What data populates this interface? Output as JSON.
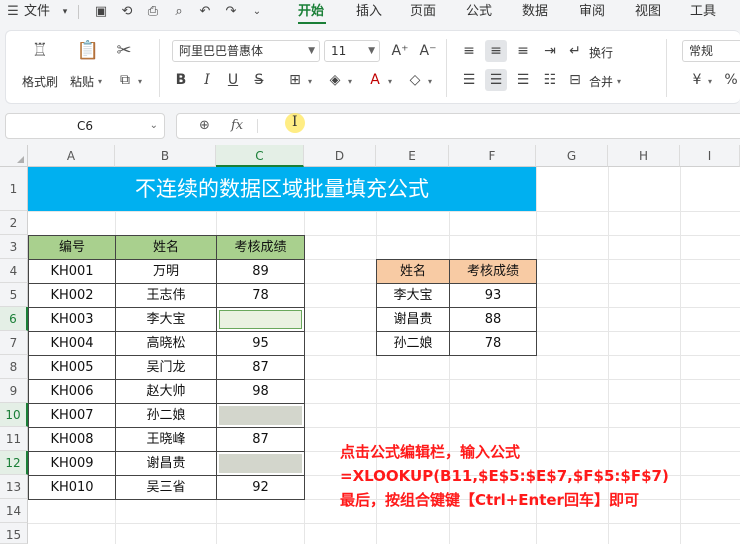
{
  "menubar": {
    "file_label": "文件",
    "tabs": [
      "开始",
      "插入",
      "页面",
      "公式",
      "数据",
      "审阅",
      "视图",
      "工具"
    ],
    "active_tab": "开始"
  },
  "ribbon": {
    "format_painter": "格式刷",
    "paste": "粘贴",
    "font_name": "阿里巴巴普惠体",
    "font_size": "11",
    "wrap": "换行",
    "merge": "合并",
    "number_format": "常规",
    "bold": "B",
    "italic": "I",
    "underline": "U",
    "currency": "¥"
  },
  "formula_bar": {
    "name_box": "C6",
    "fx": "fx",
    "formula": ""
  },
  "sheet": {
    "columns": [
      "A",
      "B",
      "C",
      "D",
      "E",
      "F",
      "G",
      "H",
      "I"
    ],
    "rows": [
      "1",
      "2",
      "3",
      "4",
      "5",
      "6",
      "7",
      "8",
      "9",
      "10",
      "11",
      "12",
      "13",
      "14",
      "15"
    ],
    "title": "不连续的数据区域批量填充公式",
    "table1": {
      "headers": [
        "编号",
        "姓名",
        "考核成绩"
      ],
      "rows": [
        [
          "KH001",
          "万明",
          "89"
        ],
        [
          "KH002",
          "王志伟",
          "78"
        ],
        [
          "KH003",
          "李大宝",
          ""
        ],
        [
          "KH004",
          "高晓松",
          "95"
        ],
        [
          "KH005",
          "吴门龙",
          "87"
        ],
        [
          "KH006",
          "赵大帅",
          "98"
        ],
        [
          "KH007",
          "孙二娘",
          ""
        ],
        [
          "KH008",
          "王晓峰",
          "87"
        ],
        [
          "KH009",
          "谢昌贵",
          ""
        ],
        [
          "KH010",
          "吴三省",
          "92"
        ]
      ]
    },
    "table2": {
      "headers": [
        "姓名",
        "考核成绩"
      ],
      "rows": [
        [
          "李大宝",
          "93"
        ],
        [
          "谢昌贵",
          "88"
        ],
        [
          "孙二娘",
          "78"
        ]
      ]
    }
  },
  "annotation": {
    "line1": "点击公式编辑栏，输入公式",
    "line2": "=XLOOKUP(B11,$E$5:$E$7,$F$5:$F$7)",
    "line3": "最后，按组合键键【Ctrl+Enter回车】即可"
  },
  "colors": {
    "accent": "#1a7f37",
    "title_bg": "#00b0f0",
    "header_green": "#a9d08e",
    "header_orange": "#f8cba4",
    "note_red": "#ff1a1a"
  }
}
